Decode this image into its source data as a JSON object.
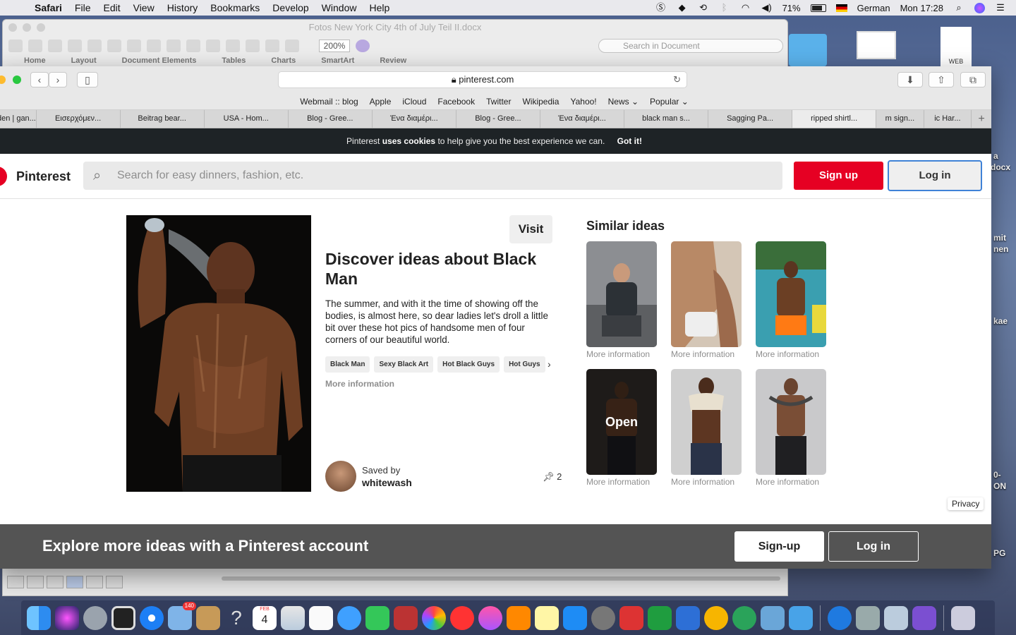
{
  "menubar": {
    "app": "Safari",
    "items": [
      "File",
      "Edit",
      "View",
      "History",
      "Bookmarks",
      "Develop",
      "Window",
      "Help"
    ],
    "battery": "71%",
    "input_language": "German",
    "clock": "Mon 17:28"
  },
  "word": {
    "title": "Fotos New York City 4th of July Teil II.docx",
    "zoom": "200%",
    "search_placeholder": "Search in Document",
    "ribbon_tabs": [
      "Home",
      "Layout",
      "Document Elements",
      "Tables",
      "Charts",
      "SmartArt",
      "Review"
    ]
  },
  "desktop": {
    "doc_label": "WEB",
    "side_labels": [
      "a",
      "docx",
      "mit",
      "nen",
      "kae",
      "0-",
      "ON",
      "PG"
    ]
  },
  "safari": {
    "url": "pinterest.com",
    "favorites": [
      "Webmail :: blog",
      "Apple",
      "iCloud",
      "Facebook",
      "Twitter",
      "Wikipedia",
      "Yahoo!",
      "News ⌄",
      "Popular ⌄"
    ],
    "tabs": [
      "den | gan...",
      "Εισερχόμεν...",
      "Beitrag bear...",
      "USA - Hom...",
      "Blog - Gree...",
      "Ένα διαμέρι...",
      "Blog - Gree...",
      "Ένα διαμέρι...",
      "black man s...",
      "Sagging Pa...",
      "ripped shirtl...",
      "m sign...",
      "ic Har..."
    ]
  },
  "pinterest": {
    "cookie_pre": "Pinterest",
    "cookie_bold": "uses cookies",
    "cookie_post": "to help give you the best experience we can.",
    "cookie_ok": "Got it!",
    "brand": "Pinterest",
    "search_placeholder": "Search for easy dinners, fashion, etc.",
    "signup": "Sign up",
    "login": "Log in",
    "visit": "Visit",
    "pin_title": "Discover ideas about Black Man",
    "pin_desc": "The summer, and with it the time of showing off the bodies, is almost here, so dear ladies let's droll a little bit over these hot pics of handsome men of four corners of our beautiful world.",
    "tags": [
      "Black Man",
      "Sexy Black Art",
      "Hot Black Guys",
      "Hot Guys"
    ],
    "more_info": "More information",
    "saved_by": "Saved by",
    "saved_user": "whitewash",
    "pin_count": "2",
    "similar_title": "Similar ideas",
    "similar": [
      {
        "label": "More information"
      },
      {
        "label": "More information"
      },
      {
        "label": "More information"
      },
      {
        "label": "More information",
        "overlay": "Open"
      },
      {
        "label": "More information"
      },
      {
        "label": "More information"
      }
    ],
    "privacy": "Privacy",
    "explore_text": "Explore more ideas with a Pinterest account",
    "explore_signup": "Sign-up",
    "explore_login": "Log in"
  },
  "dock": {
    "mail_badge": "140",
    "calendar_month": "FEB",
    "calendar_day": "4"
  }
}
